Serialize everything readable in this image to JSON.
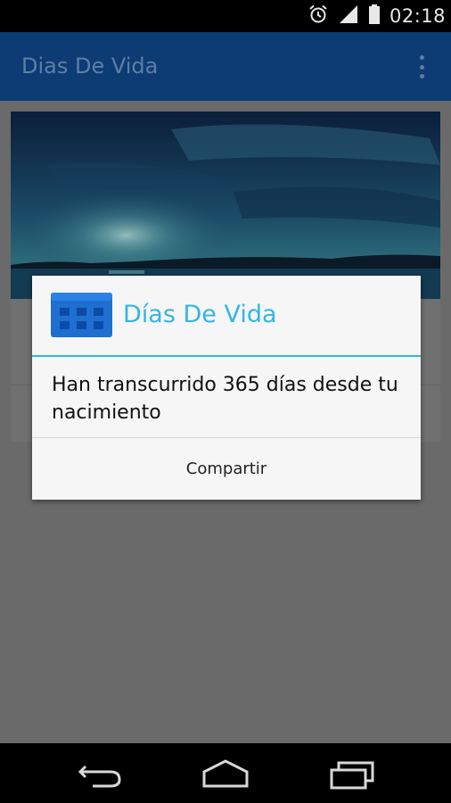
{
  "status_bar": {
    "time": "02:18",
    "icons": [
      "alarm-icon",
      "signal-icon",
      "battery-icon"
    ]
  },
  "app_bar": {
    "title": "Dias De Vida",
    "overflow_icon": "overflow-menu-icon",
    "color": "#0d3b73"
  },
  "dialog": {
    "icon": "calendar-icon",
    "title": "Días De Vida",
    "message": "Han transcurrido 365 días desde tu nacimiento",
    "button_label": "Compartir",
    "accent_color": "#33b5e5"
  },
  "nav_bar": {
    "buttons": [
      "back-icon",
      "home-icon",
      "recents-icon"
    ]
  }
}
